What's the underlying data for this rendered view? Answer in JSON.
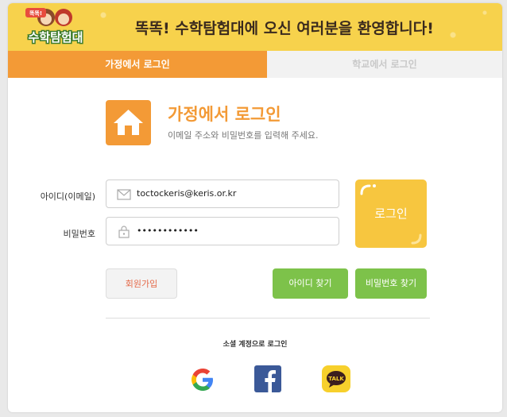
{
  "header": {
    "title": "똑똑! 수학탐험대에 오신 여러분을 환영합니다!",
    "logo_small": "똑똑!",
    "logo_main": "수학탐험대"
  },
  "tabs": [
    {
      "label": "가정에서 로그인",
      "active": true
    },
    {
      "label": "학교에서 로그인",
      "active": false
    }
  ],
  "section": {
    "title": "가정에서 로그인",
    "subtitle": "이메일 주소와 비밀번호를 입력해 주세요."
  },
  "form": {
    "id_label": "아이디(이메일)",
    "id_value": "toctockeris@keris.or.kr",
    "pw_label": "비밀번호",
    "pw_value": "••••••••••••",
    "login_label": "로그인"
  },
  "buttons": {
    "signup": "회원가입",
    "find_id": "아이디 찾기",
    "find_pw": "비밀번호 찾기"
  },
  "social": {
    "title": "소셜 계정으로 로그인",
    "kakao_text": "TALK",
    "providers": [
      "google-icon",
      "facebook-icon",
      "kakaotalk-icon"
    ]
  },
  "colors": {
    "header_yellow": "#f7d24c",
    "accent_orange": "#f39a36",
    "login_yellow": "#f7c63f",
    "green": "#7dc24a"
  }
}
